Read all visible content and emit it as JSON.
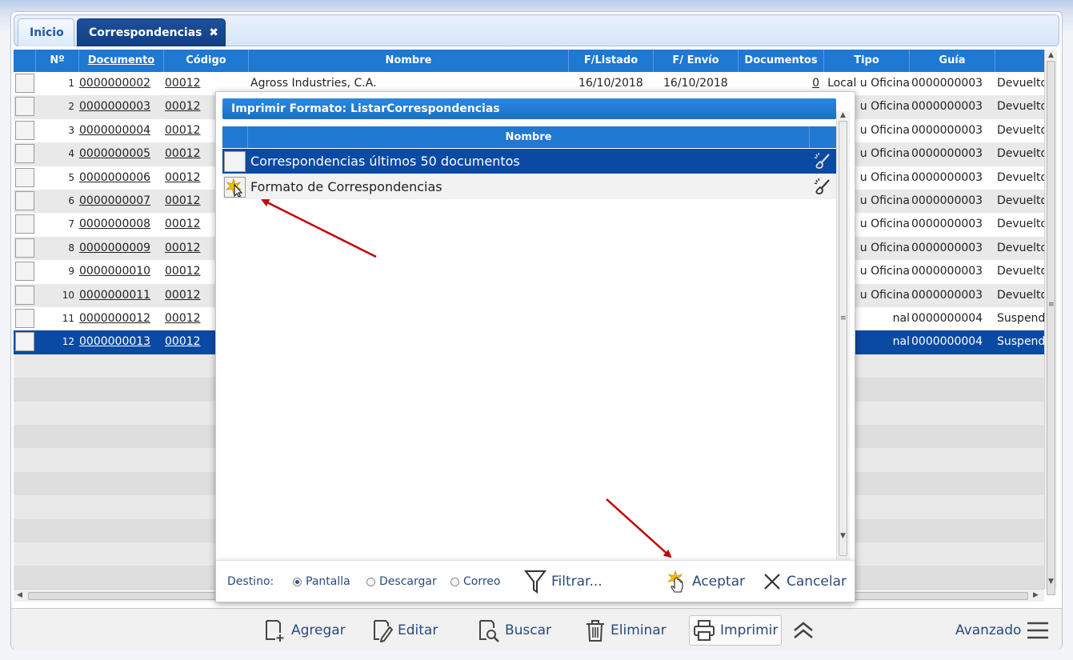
{
  "tabs": [
    {
      "label": "Inicio"
    },
    {
      "label": "Correspondencias",
      "close_glyph": "✖"
    }
  ],
  "grid": {
    "columns": [
      "Nº",
      "Documento",
      "Código",
      "Nombre",
      "F/Listado",
      "F/ Envío",
      "Documentos",
      "Tipo",
      "Guía",
      ""
    ],
    "rows": [
      {
        "n": "1",
        "documento": "0000000002",
        "codigo": "00012",
        "nombre": "Agross Industries, C.A.",
        "f_listado": "16/10/2018",
        "f_envio": "16/10/2018",
        "documentos": "0",
        "tipo": "Local u Oficina",
        "guia": "0000000003",
        "estado": "Devuelto"
      },
      {
        "n": "2",
        "documento": "0000000003",
        "codigo": "00012",
        "tipo": "u Oficina",
        "guia": "0000000003",
        "estado": "Devuelto"
      },
      {
        "n": "3",
        "documento": "0000000004",
        "codigo": "00012",
        "tipo": "u Oficina",
        "guia": "0000000003",
        "estado": "Devuelto"
      },
      {
        "n": "4",
        "documento": "0000000005",
        "codigo": "00012",
        "tipo": "u Oficina",
        "guia": "0000000003",
        "estado": "Devuelto"
      },
      {
        "n": "5",
        "documento": "0000000006",
        "codigo": "00012",
        "tipo": "u Oficina",
        "guia": "0000000003",
        "estado": "Devuelto"
      },
      {
        "n": "6",
        "documento": "0000000007",
        "codigo": "00012",
        "tipo": "u Oficina",
        "guia": "0000000003",
        "estado": "Devuelto"
      },
      {
        "n": "7",
        "documento": "0000000008",
        "codigo": "00012",
        "tipo": "u Oficina",
        "guia": "0000000003",
        "estado": "Devuelto"
      },
      {
        "n": "8",
        "documento": "0000000009",
        "codigo": "00012",
        "tipo": "u Oficina",
        "guia": "0000000003",
        "estado": "Devuelto"
      },
      {
        "n": "9",
        "documento": "0000000010",
        "codigo": "00012",
        "tipo": "u Oficina",
        "guia": "0000000003",
        "estado": "Devuelto"
      },
      {
        "n": "10",
        "documento": "0000000011",
        "codigo": "00012",
        "tipo": "u Oficina",
        "guia": "0000000003",
        "estado": "Devuelto"
      },
      {
        "n": "11",
        "documento": "0000000012",
        "codigo": "00012",
        "tipo": "nal",
        "guia": "0000000004",
        "estado": "Suspendido"
      },
      {
        "n": "12",
        "documento": "0000000013",
        "codigo": "00012",
        "tipo": "nal",
        "guia": "0000000004",
        "estado": "Suspendido"
      }
    ]
  },
  "modal": {
    "title": "Imprimir Formato: ListarCorrespondencias",
    "column": "Nombre",
    "items": [
      {
        "label": "Correspondencias últimos 50 documentos"
      },
      {
        "label": "Formato de Correspondencias"
      }
    ],
    "destino_label": "Destino:",
    "destinos": [
      "Pantalla",
      "Descargar",
      "Correo"
    ],
    "destino_selected": "Pantalla",
    "filtrar": "Filtrar...",
    "aceptar": "Aceptar",
    "cancelar": "Cancelar"
  },
  "toolbar": {
    "agregar": "Agregar",
    "editar": "Editar",
    "buscar": "Buscar",
    "eliminar": "Eliminar",
    "imprimir": "Imprimir",
    "avanzado": "Avanzado"
  },
  "colors": {
    "header_blue": "#1f78d1",
    "selection_blue": "#0b4aa2",
    "tab_active": "#123f84",
    "annotation_arrow": "#c00000"
  }
}
